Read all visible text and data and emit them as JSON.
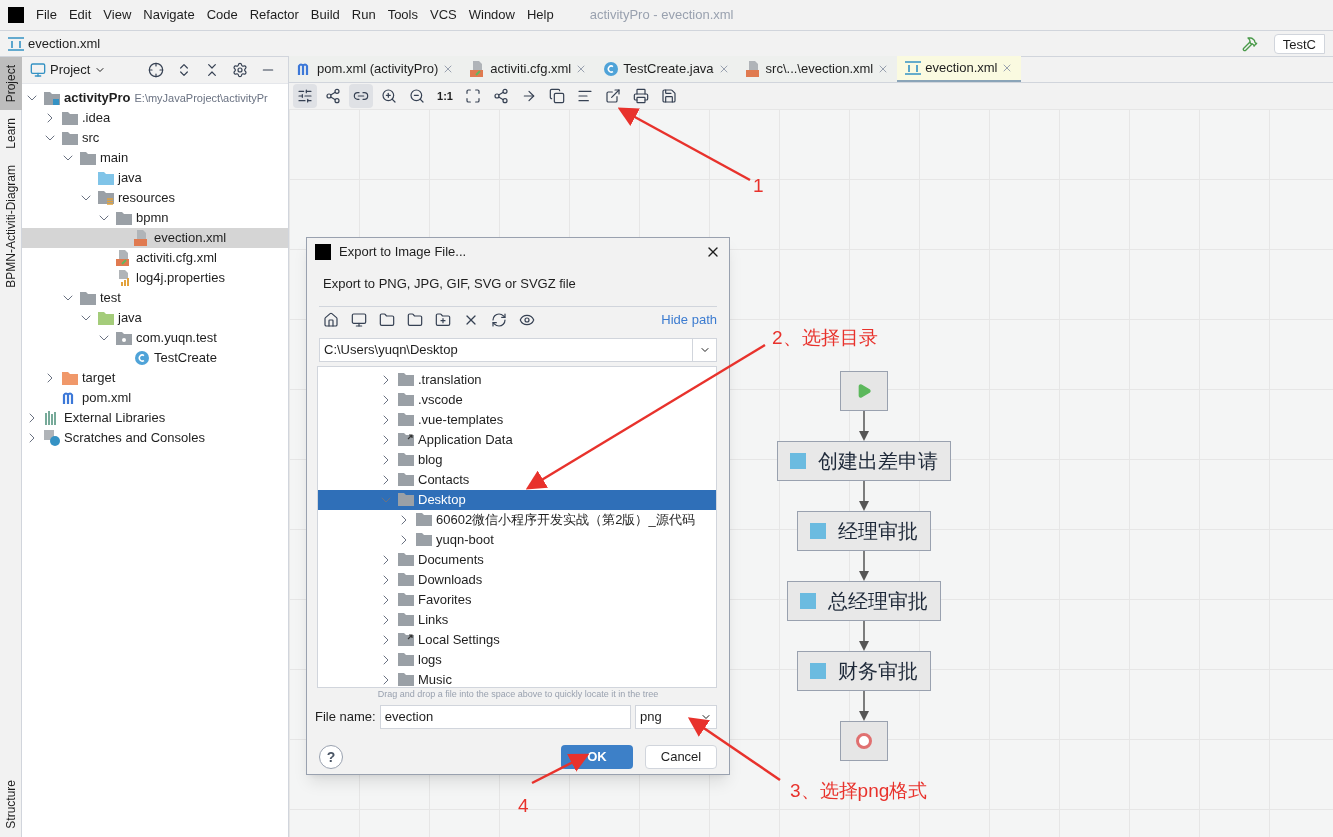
{
  "menu": [
    "File",
    "Edit",
    "View",
    "Navigate",
    "Code",
    "Refactor",
    "Build",
    "Run",
    "Tools",
    "VCS",
    "Window",
    "Help"
  ],
  "window": {
    "title": "activityPro - evection.xml"
  },
  "nav_bar": {
    "breadcrumb": "evection.xml",
    "run_config": "TestC"
  },
  "tool_strip": {
    "top": [
      {
        "label": "Project",
        "selected": true
      },
      {
        "label": "Learn",
        "selected": false
      },
      {
        "label": "BPMN-Activiti-Diagram",
        "selected": false
      }
    ],
    "bottom": [
      {
        "label": "Structure",
        "selected": false
      }
    ]
  },
  "project_panel": {
    "title": "Project",
    "tree": [
      {
        "label": "activityPro",
        "path": "E:\\myJavaProject\\activityPr",
        "kind": "module",
        "expanded": true,
        "selected": false,
        "children": [
          {
            "label": ".idea",
            "kind": "folder",
            "expanded": false,
            "selected": false
          },
          {
            "label": "src",
            "kind": "folder",
            "expanded": true,
            "selected": false,
            "children": [
              {
                "label": "main",
                "kind": "folder",
                "expanded": true,
                "selected": false,
                "children": [
                  {
                    "label": "java",
                    "kind": "source",
                    "selected": false
                  },
                  {
                    "label": "resources",
                    "kind": "resources",
                    "expanded": true,
                    "selected": false,
                    "children": [
                      {
                        "label": "bpmn",
                        "kind": "folder",
                        "expanded": true,
                        "selected": false,
                        "children": [
                          {
                            "label": "evection.xml",
                            "kind": "xml",
                            "selected": true
                          }
                        ]
                      },
                      {
                        "label": "activiti.cfg.xml",
                        "kind": "config",
                        "selected": false
                      },
                      {
                        "label": "log4j.properties",
                        "kind": "properties",
                        "selected": false
                      }
                    ]
                  }
                ]
              },
              {
                "label": "test",
                "kind": "folder",
                "expanded": true,
                "selected": false,
                "children": [
                  {
                    "label": "java",
                    "kind": "test",
                    "expanded": true,
                    "selected": false,
                    "children": [
                      {
                        "label": "com.yuqn.test",
                        "kind": "package",
                        "expanded": true,
                        "selected": false,
                        "children": [
                          {
                            "label": "TestCreate",
                            "kind": "class",
                            "selected": false
                          }
                        ]
                      }
                    ]
                  }
                ]
              }
            ]
          },
          {
            "label": "target",
            "kind": "excluded",
            "expanded": false,
            "selected": false
          },
          {
            "label": "pom.xml",
            "kind": "maven",
            "selected": false
          }
        ]
      },
      {
        "label": "External Libraries",
        "kind": "libraries",
        "expanded": false,
        "selected": false
      },
      {
        "label": "Scratches and Consoles",
        "kind": "scratches",
        "expanded": false,
        "selected": false
      }
    ]
  },
  "editor_tabs": [
    {
      "label": "pom.xml (activityPro)",
      "kind": "maven",
      "selected": false
    },
    {
      "label": "activiti.cfg.xml",
      "kind": "config",
      "selected": false
    },
    {
      "label": "TestCreate.java",
      "kind": "class",
      "selected": false
    },
    {
      "label": "src\\...\\evection.xml",
      "kind": "xml",
      "selected": false
    },
    {
      "label": "evection.xml",
      "kind": "diagram",
      "selected": true
    }
  ],
  "diagram_toolbar": {
    "zoom_reset": "1:1"
  },
  "diagram": [
    {
      "kind": "start"
    },
    {
      "kind": "task",
      "label": "创建出差申请"
    },
    {
      "kind": "task",
      "label": "经理审批"
    },
    {
      "kind": "task",
      "label": "总经理审批"
    },
    {
      "kind": "task",
      "label": "财务审批"
    },
    {
      "kind": "end"
    }
  ],
  "dialog": {
    "title": "Export to Image File...",
    "subtitle": "Export to PNG, JPG, GIF, SVG or SVGZ file",
    "hide_path": "Hide path",
    "path": "C:\\Users\\yuqn\\Desktop",
    "tree": [
      {
        "label": ".translation",
        "kind": "folder",
        "expanded": false,
        "selected": false
      },
      {
        "label": ".vscode",
        "kind": "folder",
        "expanded": false,
        "selected": false
      },
      {
        "label": ".vue-templates",
        "kind": "folder",
        "expanded": false,
        "selected": false
      },
      {
        "label": "Application Data",
        "kind": "link",
        "expanded": false,
        "selected": false
      },
      {
        "label": "blog",
        "kind": "folder",
        "expanded": false,
        "selected": false
      },
      {
        "label": "Contacts",
        "kind": "folder",
        "expanded": false,
        "selected": false
      },
      {
        "label": "Desktop",
        "kind": "folder",
        "expanded": true,
        "selected": true,
        "children": [
          {
            "label": "60602微信小程序开发实战（第2版）_源代码",
            "kind": "folder",
            "expanded": false,
            "selected": false
          },
          {
            "label": "yuqn-boot",
            "kind": "folder",
            "expanded": false,
            "selected": false
          }
        ]
      },
      {
        "label": "Documents",
        "kind": "folder",
        "expanded": false,
        "selected": false
      },
      {
        "label": "Downloads",
        "kind": "folder",
        "expanded": false,
        "selected": false
      },
      {
        "label": "Favorites",
        "kind": "folder",
        "expanded": false,
        "selected": false
      },
      {
        "label": "Links",
        "kind": "folder",
        "expanded": false,
        "selected": false
      },
      {
        "label": "Local Settings",
        "kind": "link",
        "expanded": false,
        "selected": false
      },
      {
        "label": "logs",
        "kind": "folder",
        "expanded": false,
        "selected": false
      },
      {
        "label": "Music",
        "kind": "folder",
        "expanded": false,
        "selected": false
      }
    ],
    "hint": "Drag and drop a file into the space above to quickly locate it in the tree",
    "file_name_label": "File name:",
    "file_name": "evection",
    "format": "png",
    "ok": "OK",
    "cancel": "Cancel",
    "help": "?"
  },
  "annotations": [
    {
      "label": "1"
    },
    {
      "label": "2、选择目录"
    },
    {
      "label": "3、选择png格式"
    },
    {
      "label": "4"
    }
  ]
}
